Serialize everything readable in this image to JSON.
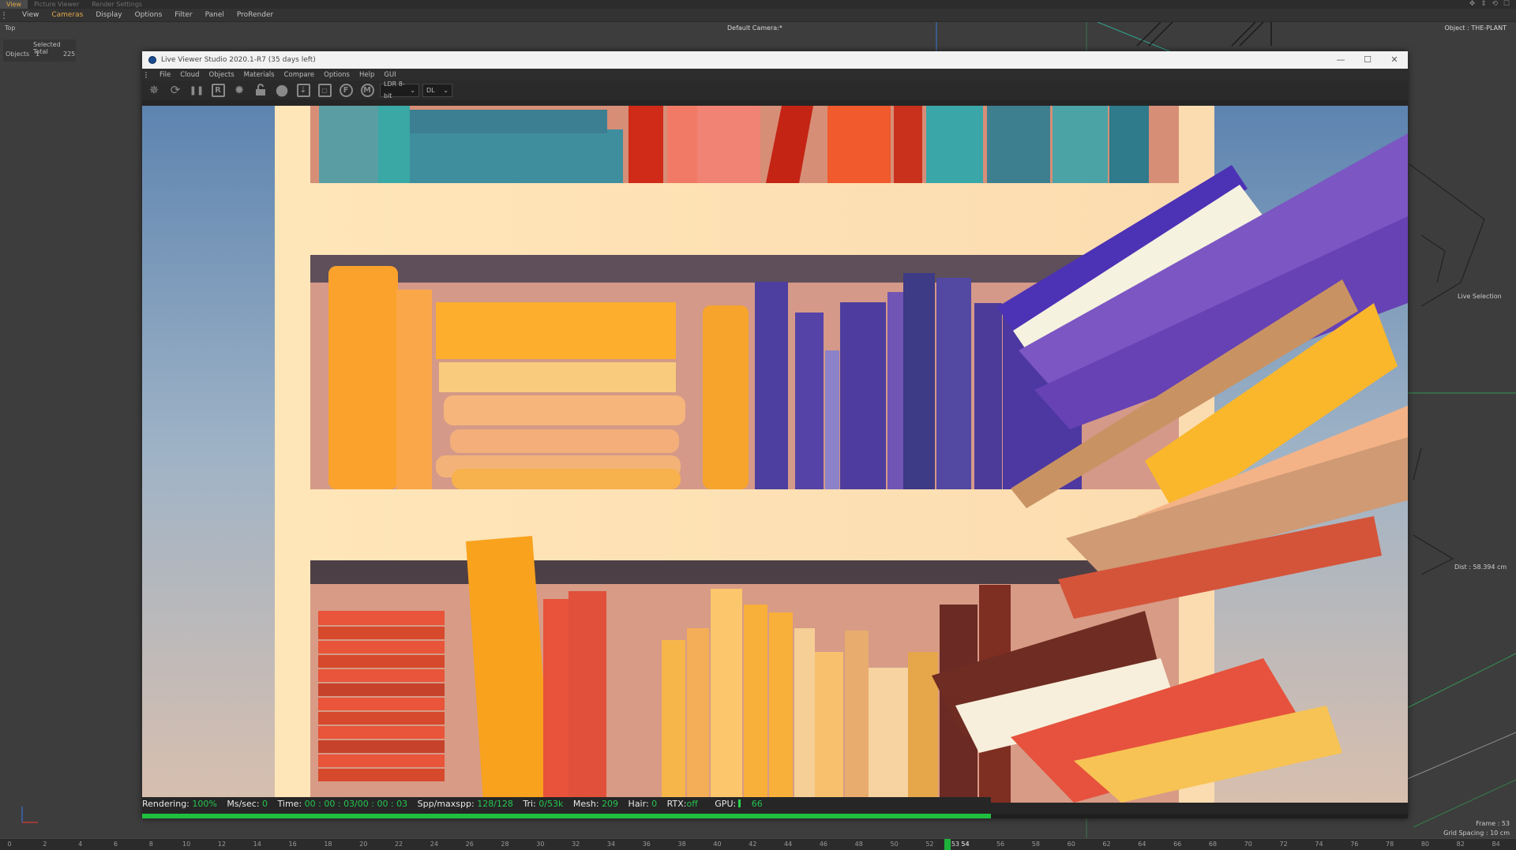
{
  "app": {
    "tabs": [
      "View",
      "Picture Viewer",
      "Render Settings"
    ],
    "active_tab": "View"
  },
  "viewport": {
    "menus": [
      "View",
      "Cameras",
      "Display",
      "Options",
      "Filter",
      "Panel",
      "ProRender"
    ],
    "highlight_menu": "Cameras",
    "view_label": "Top",
    "camera_label": "Default Camera",
    "camera_suffix": ":*",
    "object_label": "Object : THE-PLANT",
    "live_selection": "Live Selection",
    "distance": "Dist : 58.394 cm",
    "frame": "Frame : 53",
    "grid_spacing": "Grid Spacing : 10 cm",
    "stats": {
      "header": "Selected Total",
      "row_label": "Objects",
      "selected": "1",
      "total": "225"
    }
  },
  "timeline": {
    "ticks": [
      "0",
      "2",
      "4",
      "6",
      "8",
      "10",
      "12",
      "14",
      "16",
      "18",
      "20",
      "22",
      "24",
      "26",
      "28",
      "30",
      "32",
      "34",
      "36",
      "38",
      "40",
      "42",
      "44",
      "46",
      "48",
      "50",
      "52",
      "54",
      "56",
      "58",
      "60",
      "62",
      "64",
      "66",
      "68",
      "70",
      "72",
      "74",
      "76",
      "78",
      "80",
      "82",
      "84"
    ],
    "current_frame": "53",
    "current_frame_label": "53 54",
    "playhead_color": "#1db33a"
  },
  "live_viewer": {
    "title": "Live Viewer Studio 2020.1-R7 (35 days left)",
    "menus": [
      "File",
      "Cloud",
      "Objects",
      "Materials",
      "Compare",
      "Options",
      "Help",
      "GUI"
    ],
    "toolbar_icons": [
      "render-start-icon",
      "refresh-icon",
      "pause-icon",
      "region-icon",
      "settings-gear-icon",
      "lock-icon",
      "material-sphere-icon",
      "export-icon",
      "clay-icon",
      "focus-picker-icon",
      "material-picker-icon"
    ],
    "toolbar_region_letter": "R",
    "toolbar_icon_glyphs": {
      "render": "✵",
      "refresh": "⟳",
      "pause": "❚❚",
      "gear": "✹",
      "lock": "🔓",
      "sphere": "●",
      "export": "⇣",
      "clay": "▢",
      "focus": "F",
      "picker": "M"
    },
    "colorspace_select": "LDR 8-bit",
    "kernel_select": "DL",
    "window_controls": {
      "minimize": "—",
      "maximize": "☐",
      "close": "✕"
    },
    "status": {
      "rendering_label": "Rendering:",
      "rendering_value": "100%",
      "ms_label": "Ms/sec:",
      "ms_value": "0",
      "time_label": "Time:",
      "time_value": "00 : 00 : 03/00 : 00 : 03",
      "spp_label": "Spp/maxspp:",
      "spp_value": "128/128",
      "tri_label": "Tri:",
      "tri_value": "0/53k",
      "mesh_label": "Mesh:",
      "mesh_value": "209",
      "hair_label": "Hair:",
      "hair_value": "0",
      "rtx_label": "RTX:",
      "rtx_value": "off",
      "gpu_label": "GPU:",
      "gpu_value": "66"
    },
    "render_progress": 1.0,
    "accent_color": "#1fbf3f"
  }
}
